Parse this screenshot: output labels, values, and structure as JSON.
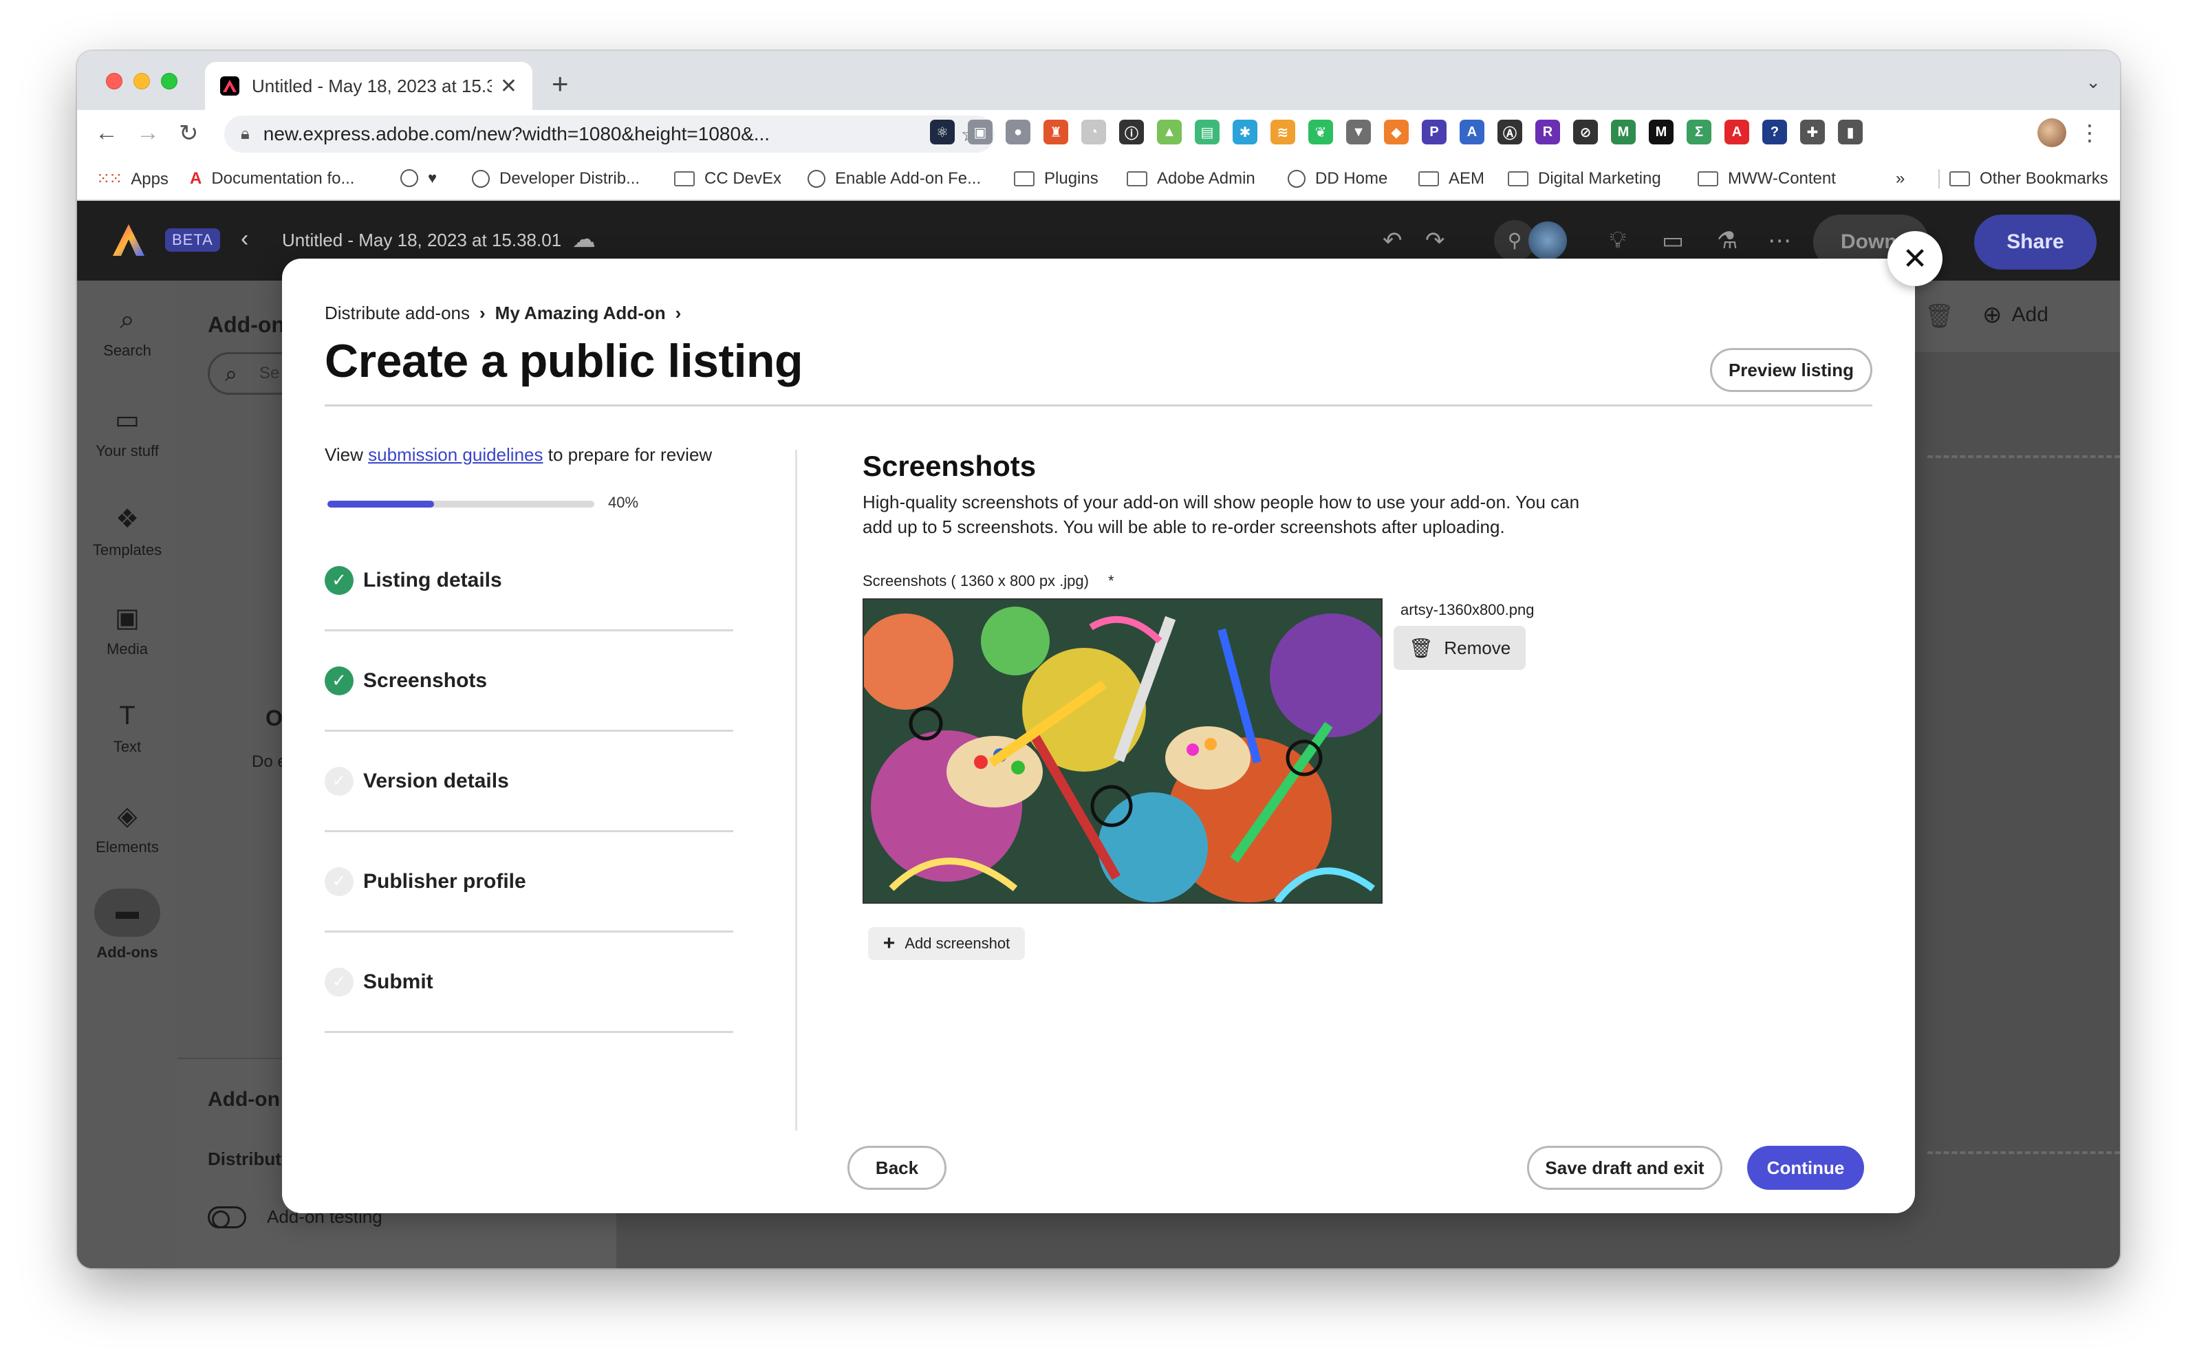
{
  "browser": {
    "tab_title": "Untitled - May 18, 2023 at 15.3",
    "url": "new.express.adobe.com/new?width=1080&height=1080&...",
    "extensions": [
      {
        "icon": "react-icon",
        "color": "#1e2a44",
        "glyph": "⚛"
      },
      {
        "icon": "chat-icon",
        "color": "#8a8f99",
        "glyph": "▣"
      },
      {
        "icon": "puzzle-badge-icon",
        "color": "#8a8f99",
        "glyph": "●"
      },
      {
        "icon": "lighthouse-icon",
        "color": "#e0552b",
        "glyph": "♜"
      },
      {
        "icon": "timer-icon",
        "color": "#c7c7c7",
        "glyph": "◔"
      },
      {
        "icon": "info-icon",
        "color": "#333333",
        "glyph": "ⓘ"
      },
      {
        "icon": "android-icon",
        "color": "#78c257",
        "glyph": "▲"
      },
      {
        "icon": "screen-icon",
        "color": "#3fb97a",
        "glyph": "▤"
      },
      {
        "icon": "asterisk-icon",
        "color": "#2ba3d8",
        "glyph": "✱"
      },
      {
        "icon": "rss-icon",
        "color": "#f0a030",
        "glyph": "≋"
      },
      {
        "icon": "evernote-icon",
        "color": "#2dbe60",
        "glyph": "❦"
      },
      {
        "icon": "vue-icon",
        "color": "#6f6f6f",
        "glyph": "▼"
      },
      {
        "icon": "orange-tool-icon",
        "color": "#ef7f2a",
        "glyph": "◆"
      },
      {
        "icon": "p-icon",
        "color": "#4a3fb0",
        "glyph": "P"
      },
      {
        "icon": "a-brackets-icon",
        "color": "#3567c9",
        "glyph": "A"
      },
      {
        "icon": "a-circle-icon",
        "color": "#333333",
        "glyph": "Ⓐ"
      },
      {
        "icon": "r-icon",
        "color": "#6b2fb3",
        "glyph": "R"
      },
      {
        "icon": "no-tracking-icon",
        "color": "#333333",
        "glyph": "⊘"
      },
      {
        "icon": "m-icon",
        "color": "#2e8c4e",
        "glyph": "M"
      },
      {
        "icon": "medium-icon",
        "color": "#111111",
        "glyph": "M"
      },
      {
        "icon": "sigma-icon",
        "color": "#3a9f5f",
        "glyph": "Σ"
      },
      {
        "icon": "adobe-red-icon",
        "color": "#e3262b",
        "glyph": "A"
      },
      {
        "icon": "shield-icon",
        "color": "#1f3c88",
        "glyph": "?"
      },
      {
        "icon": "puzzle-icon",
        "color": "#555555",
        "glyph": "✚"
      },
      {
        "icon": "sidebar-icon",
        "color": "#555555",
        "glyph": "▮"
      }
    ],
    "bookmarks": [
      {
        "label": "Apps",
        "icon": "apps-grid-icon"
      },
      {
        "label": "Documentation fo...",
        "icon": "adobe-icon"
      },
      {
        "label": "",
        "icon": "heart-icon"
      },
      {
        "label": "Developer Distrib...",
        "icon": "globe-icon"
      },
      {
        "label": "CC DevEx",
        "icon": "folder-icon"
      },
      {
        "label": "Enable Add-on Fe...",
        "icon": "globe-icon"
      },
      {
        "label": "Plugins",
        "icon": "folder-icon"
      },
      {
        "label": "Adobe Admin",
        "icon": "folder-icon"
      },
      {
        "label": "DD Home",
        "icon": "globe-icon"
      },
      {
        "label": "AEM",
        "icon": "folder-icon"
      },
      {
        "label": "Digital Marketing",
        "icon": "folder-icon"
      },
      {
        "label": "MWW-Content",
        "icon": "folder-icon"
      }
    ],
    "overflow_label": "»",
    "other_bookmarks": "Other Bookmarks"
  },
  "app": {
    "beta": "BETA",
    "doc_title": "Untitled - May 18, 2023 at 15.38.01",
    "download_label": "Down",
    "share_label": "Share",
    "rail": [
      {
        "label": "Search",
        "icon": "search-icon",
        "glyph": "⌕"
      },
      {
        "label": "Your stuff",
        "icon": "folder-icon",
        "glyph": "▭"
      },
      {
        "label": "Templates",
        "icon": "templates-icon",
        "glyph": "❖"
      },
      {
        "label": "Media",
        "icon": "media-icon",
        "glyph": "▣"
      },
      {
        "label": "Text",
        "icon": "text-icon",
        "glyph": "T"
      },
      {
        "label": "Elements",
        "icon": "elements-icon",
        "glyph": "◈"
      },
      {
        "label": "Add-ons",
        "icon": "add-ons-icon",
        "glyph": "▬"
      }
    ],
    "panel_title": "Add-on",
    "panel_search_placeholder": "Se",
    "panel_body_heading": "O",
    "panel_body_text": "Do e",
    "panel_lower_title": "Add-on",
    "panel_lower_subtitle": "Distribut",
    "addon_testing_label": "Add-on testing",
    "canvas_add_label": "Add"
  },
  "modal": {
    "breadcrumb": [
      "Distribute add-ons",
      "My Amazing Add-on"
    ],
    "title": "Create a public listing",
    "preview_label": "Preview listing",
    "guidelines_prefix": "View",
    "guidelines_link": "submission guidelines",
    "guidelines_suffix": "to prepare for review",
    "progress_percent": 40,
    "progress_label": "40%",
    "steps": [
      {
        "label": "Listing details",
        "done": true
      },
      {
        "label": "Screenshots",
        "done": true
      },
      {
        "label": "Version details",
        "done": false
      },
      {
        "label": "Publisher profile",
        "done": false
      },
      {
        "label": "Submit",
        "done": false
      }
    ],
    "section_title": "Screenshots",
    "section_desc": "High-quality screenshots of your add-on will show people how to use your add-on. You can add up to 5 screenshots. You will be able to re-order screenshots after uploading.",
    "field_label": "Screenshots ( 1360 x 800 px .jpg)",
    "required_mark": "*",
    "file_name": "artsy-1360x800.png",
    "remove_label": "Remove",
    "add_screenshot_label": "Add screenshot",
    "back_label": "Back",
    "save_label": "Save draft and exit",
    "continue_label": "Continue"
  },
  "colors": {
    "accent": "#4b4fd6",
    "success": "#2d9a62"
  }
}
